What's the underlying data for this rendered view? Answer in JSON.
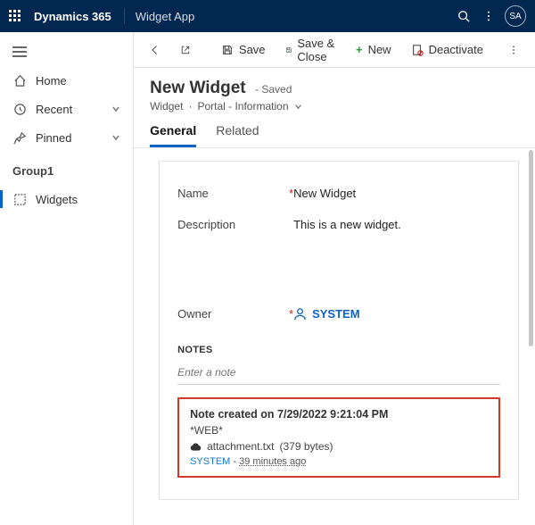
{
  "topbar": {
    "brand": "Dynamics 365",
    "app": "Widget App",
    "avatar": "SA"
  },
  "sidebar": {
    "home": "Home",
    "recent": "Recent",
    "pinned": "Pinned",
    "group": "Group1",
    "widgets": "Widgets"
  },
  "cmdbar": {
    "save": "Save",
    "save_close": "Save & Close",
    "new": "New",
    "deactivate": "Deactivate"
  },
  "header": {
    "title": "New Widget",
    "saved": "- Saved",
    "entity": "Widget",
    "form": "Portal - Information"
  },
  "tabs": {
    "general": "General",
    "related": "Related"
  },
  "form": {
    "name_label": "Name",
    "name_value": "New Widget",
    "desc_label": "Description",
    "desc_value": "This is a new widget.",
    "owner_label": "Owner",
    "owner_value": "SYSTEM"
  },
  "notes": {
    "heading": "NOTES",
    "placeholder": "Enter a note",
    "note_title": "Note created on 7/29/2022 9:21:04 PM",
    "web": "*WEB*",
    "attachment_name": "attachment.txt",
    "attachment_size": "(379 bytes)",
    "author": "SYSTEM",
    "ago": "39 minutes ago"
  }
}
